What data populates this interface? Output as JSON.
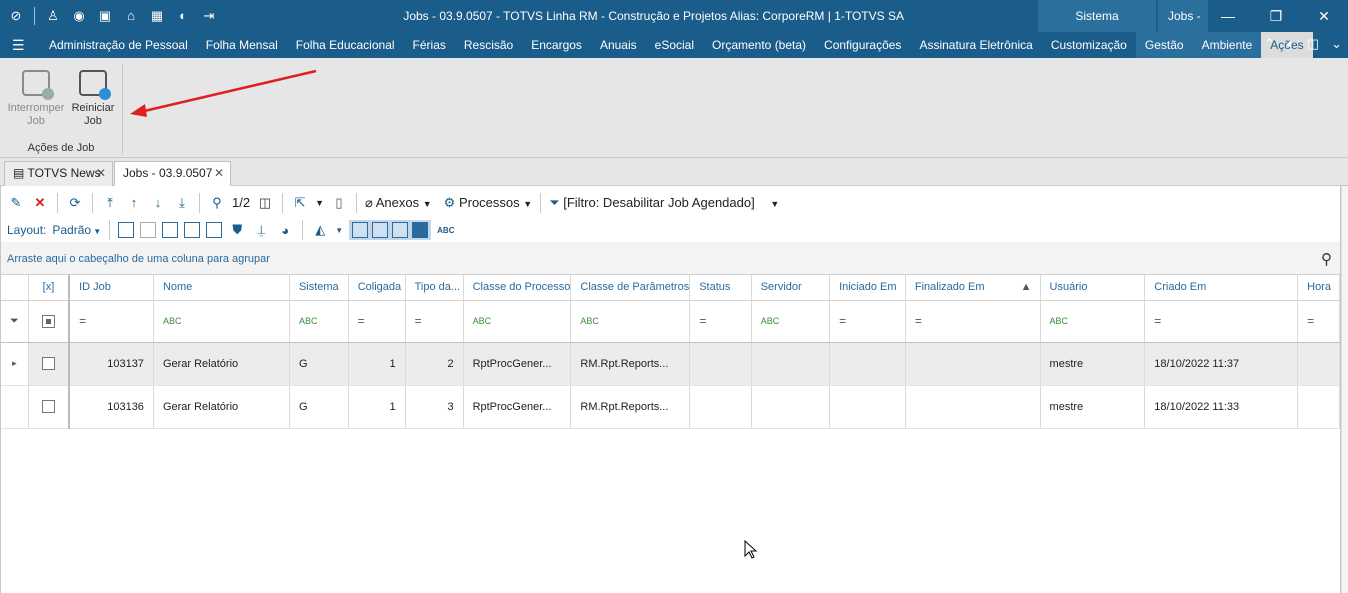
{
  "window": {
    "title": "Jobs - 03.9.0507 - TOTVS Linha RM - Construção e Projetos  Alias: CorporeRM | 1-TOTVS SA",
    "context_sistema": "Sistema",
    "context_jobs": "Jobs -"
  },
  "menu": {
    "items": [
      "Administração de Pessoal",
      "Folha Mensal",
      "Folha Educacional",
      "Férias",
      "Rescisão",
      "Encargos",
      "Anuais",
      "eSocial",
      "Orçamento (beta)",
      "Configurações",
      "Assinatura Eletrônica",
      "Customização",
      "Gestão",
      "Ambiente",
      "Ações"
    ]
  },
  "ribbon": {
    "interromper": "Interromper Job",
    "reiniciar": "Reiniciar Job",
    "group_label": "Ações de Job"
  },
  "tabs": [
    {
      "label": "TOTVS News"
    },
    {
      "label": "Jobs - 03.9.0507"
    }
  ],
  "toolbar": {
    "page": "1/2",
    "anexos": "Anexos",
    "processos": "Processos",
    "filtro": "[Filtro: Desabilitar Job Agendado]",
    "layout_label": "Layout:",
    "layout_value": "Padrão"
  },
  "grid": {
    "group_hint": "Arraste aqui o cabeçalho de uma coluna para agrupar",
    "columns": [
      "[x]",
      "ID Job",
      "Nome",
      "Sistema",
      "Coligada",
      "Tipo da...",
      "Classe do Processo",
      "Classe de Parâmetros",
      "Status",
      "Servidor",
      "Iniciado Em",
      "Finalizado Em",
      "Usuário",
      "Criado Em",
      "Hora"
    ],
    "filter_abc": "ABC",
    "filter_eq": "=",
    "rows": [
      {
        "id": "103137",
        "nome": "Gerar Relatório",
        "sistema": "G",
        "coligada": "1",
        "tipo": "2",
        "classe_proc": "RptProcGener...",
        "classe_param": "RM.Rpt.Reports...",
        "status": "",
        "servidor": "",
        "iniciado": "",
        "finalizado": "",
        "usuario": "mestre",
        "criado": "18/10/2022 11:37",
        "hora": ""
      },
      {
        "id": "103136",
        "nome": "Gerar Relatório",
        "sistema": "G",
        "coligada": "1",
        "tipo": "3",
        "classe_proc": "RptProcGener...",
        "classe_param": "RM.Rpt.Reports...",
        "status": "",
        "servidor": "",
        "iniciado": "",
        "finalizado": "",
        "usuario": "mestre",
        "criado": "18/10/2022 11:33",
        "hora": ""
      }
    ]
  },
  "colors": {
    "titlebar": "#1a5c8a",
    "accent": "#2a6a9e",
    "arrow": "#e02020"
  }
}
